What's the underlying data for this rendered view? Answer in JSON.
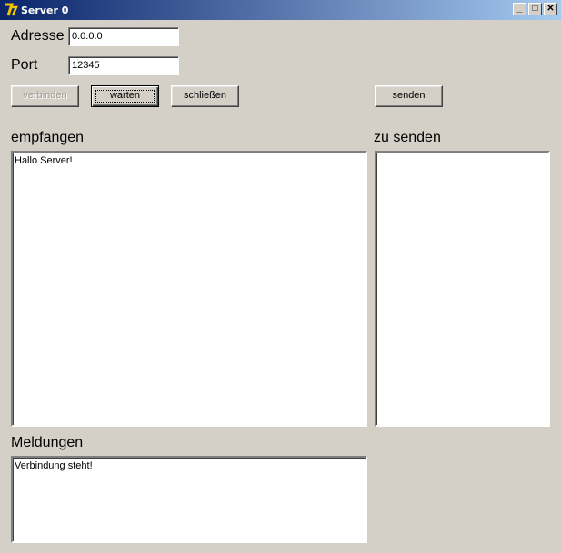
{
  "window": {
    "title": "Server 0",
    "icon": "java-icon",
    "controls": {
      "minimize": "_",
      "maximize": "□",
      "close": "✕"
    }
  },
  "form": {
    "address_label": "Adresse",
    "address_value": "0.0.0.0",
    "port_label": "Port",
    "port_value": "12345"
  },
  "buttons": {
    "connect": "verbinden",
    "wait": "warten",
    "close": "schließen",
    "send": "senden"
  },
  "received": {
    "label": "empfangen",
    "text": "Hallo Server!"
  },
  "to_send": {
    "label": "zu senden",
    "text": ""
  },
  "messages": {
    "label": "Meldungen",
    "text": "Verbindung steht!"
  }
}
